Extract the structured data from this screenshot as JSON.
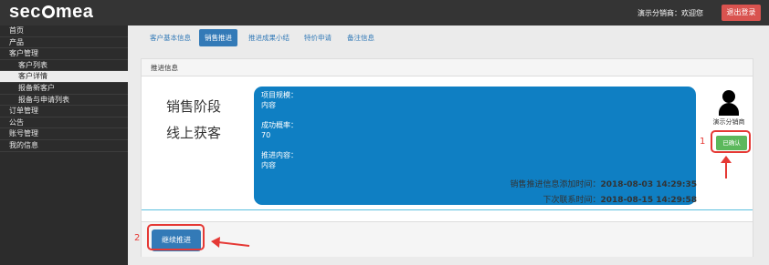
{
  "header": {
    "logo": "secomea",
    "welcome": "演示分销商：欢迎您",
    "logout_label": "退出登录"
  },
  "sidebar": {
    "items": [
      {
        "label": "首页"
      },
      {
        "label": "产品"
      },
      {
        "label": "客户管理"
      },
      {
        "label": "客户列表"
      },
      {
        "label": "客户详情"
      },
      {
        "label": "报备新客户"
      },
      {
        "label": "报备与申请列表"
      },
      {
        "label": "订单管理"
      },
      {
        "label": "公告"
      },
      {
        "label": "账号管理"
      },
      {
        "label": "我的信息"
      }
    ]
  },
  "tabs": [
    {
      "label": "客户基本信息"
    },
    {
      "label": "销售推进"
    },
    {
      "label": "推进成果小结"
    },
    {
      "label": "特价申请"
    },
    {
      "label": "备注信息"
    }
  ],
  "panel": {
    "title": "推进信息",
    "stage_lines": [
      "销售阶段",
      "线上获客"
    ],
    "bubble": {
      "scale_label": "项目规模：",
      "scale_value": "内容",
      "rate_label": "成功概率：",
      "rate_value": "70",
      "content_label": "推进内容：",
      "content_value": "内容"
    },
    "role_label": "演示分销商",
    "confirm_label": "已确认",
    "added_label": "销售推进信息添加时间：",
    "added_time": "2018-08-03 14:29:35",
    "next_label": "下次联系时间：",
    "next_time": "2018-08-15 14:29:58",
    "continue_label": "继续推进"
  },
  "annotations": {
    "one": "1",
    "two": "2",
    "color": "#e53935"
  },
  "colors": {
    "topbar": "#343434",
    "sidebar": "#2c2c2c",
    "primary": "#337ab7",
    "bubble": "#0f7fc3",
    "success": "#5cb85c",
    "danger": "#d9534f"
  }
}
